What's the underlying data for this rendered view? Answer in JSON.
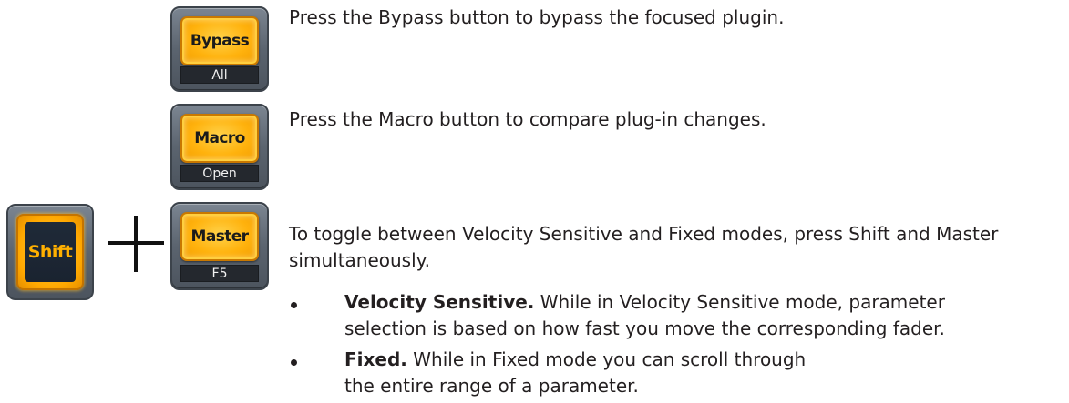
{
  "buttons": {
    "bypass": {
      "label": "Bypass",
      "sublabel": "All"
    },
    "macro": {
      "label": "Macro",
      "sublabel": "Open"
    },
    "master": {
      "label": "Master",
      "sublabel": "F5"
    },
    "shift": {
      "label": "Shift"
    }
  },
  "plus_icon": "plus-icon",
  "descriptions": {
    "bypass": "Press the Bypass button to bypass the focused plugin.",
    "macro": "Press the Macro button to compare plug-in changes.",
    "toggle_line_1": "To toggle between Velocity Sensitive and Fixed modes, press Shift and Master",
    "toggle_line_2": "simultaneously."
  },
  "bullets": [
    {
      "term": "Velocity Sensitive.",
      "line_1_rest": " While in Velocity Sensitive mode, parameter",
      "line_2": "selection is based on how fast you move the corresponding fader."
    },
    {
      "term": "Fixed.",
      "line_1_rest": " While in Fixed mode you can scroll through",
      "line_2": "the entire range of a parameter."
    }
  ],
  "colors": {
    "button_amber": "#ffb20d",
    "button_body": "#5b646f",
    "sublabel_bg": "#24282e",
    "shift_face": "#1f2a38",
    "text": "#231f20"
  }
}
